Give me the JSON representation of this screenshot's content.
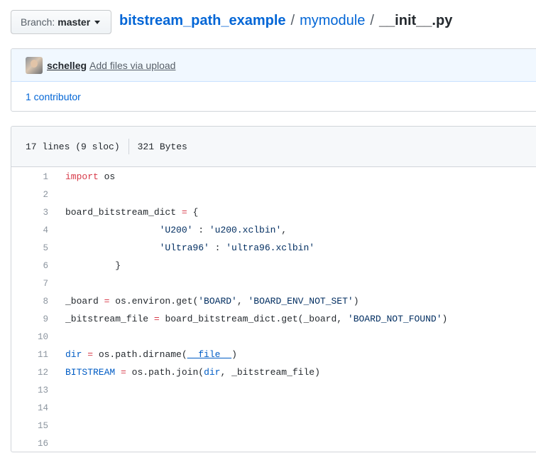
{
  "branch": {
    "prefix": "Branch:",
    "name": "master"
  },
  "breadcrumb": {
    "repo": "bitstream_path_example",
    "folder": "mymodule",
    "file": "__init__.py",
    "separator": "/"
  },
  "commit": {
    "author": "schelleg",
    "message": "Add files via upload",
    "contributors": "1 contributor"
  },
  "file_info": {
    "lines": "17 lines (9 sloc)",
    "size": "321 Bytes"
  },
  "code_lines": [
    {
      "num": "1",
      "tokens": [
        [
          "kw",
          "import"
        ],
        [
          "",
          ""
        ],
        [
          "",
          " os"
        ]
      ]
    },
    {
      "num": "2",
      "tokens": []
    },
    {
      "num": "3",
      "tokens": [
        [
          "",
          "board_bitstream_dict "
        ],
        [
          "op",
          "="
        ],
        [
          "",
          " {"
        ]
      ]
    },
    {
      "num": "4",
      "tokens": [
        [
          "",
          "                 "
        ],
        [
          "str",
          "'U200'"
        ],
        [
          "",
          " : "
        ],
        [
          "str",
          "'u200.xclbin'"
        ],
        [
          "",
          ","
        ]
      ]
    },
    {
      "num": "5",
      "tokens": [
        [
          "",
          "                 "
        ],
        [
          "str",
          "'Ultra96'"
        ],
        [
          "",
          " : "
        ],
        [
          "str",
          "'ultra96.xclbin'"
        ]
      ]
    },
    {
      "num": "6",
      "tokens": [
        [
          "",
          "         }"
        ]
      ]
    },
    {
      "num": "7",
      "tokens": []
    },
    {
      "num": "8",
      "tokens": [
        [
          "",
          "_board "
        ],
        [
          "op",
          "="
        ],
        [
          "",
          " os.environ.get("
        ],
        [
          "str",
          "'BOARD'"
        ],
        [
          "",
          ", "
        ],
        [
          "str",
          "'BOARD_ENV_NOT_SET'"
        ],
        [
          "",
          ")"
        ]
      ]
    },
    {
      "num": "9",
      "tokens": [
        [
          "",
          "_bitstream_file "
        ],
        [
          "op",
          "="
        ],
        [
          "",
          " board_bitstream_dict.get(_board, "
        ],
        [
          "str",
          "'BOARD_NOT_FOUND'"
        ],
        [
          "",
          ")"
        ]
      ]
    },
    {
      "num": "10",
      "tokens": []
    },
    {
      "num": "11",
      "tokens": [
        [
          "bi",
          "dir"
        ],
        [
          "",
          " "
        ],
        [
          "op",
          "="
        ],
        [
          "",
          " os.path.dirname("
        ],
        [
          "bi-u",
          "__file__"
        ],
        [
          "",
          ")"
        ]
      ]
    },
    {
      "num": "12",
      "tokens": [
        [
          "bi",
          "BITSTREAM"
        ],
        [
          "",
          " "
        ],
        [
          "op",
          "="
        ],
        [
          "",
          " os.path.join("
        ],
        [
          "bi",
          "dir"
        ],
        [
          "",
          ", _bitstream_file)"
        ]
      ]
    },
    {
      "num": "13",
      "tokens": []
    },
    {
      "num": "14",
      "tokens": []
    },
    {
      "num": "15",
      "tokens": []
    },
    {
      "num": "16",
      "tokens": []
    }
  ]
}
